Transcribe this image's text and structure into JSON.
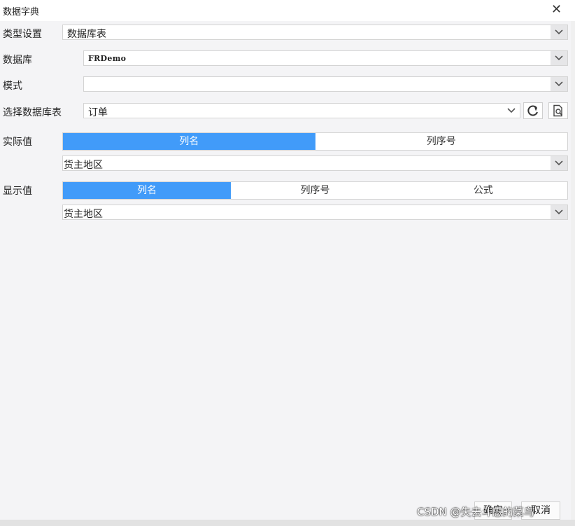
{
  "window": {
    "title": "数据字典",
    "close_label": "✕"
  },
  "fields": {
    "type_setting": {
      "label": "类型设置",
      "value": "数据库表"
    },
    "database": {
      "label": "数据库",
      "value": "FRDemo"
    },
    "schema": {
      "label": "模式",
      "value": ""
    },
    "table": {
      "label": "选择数据库表",
      "value": "订单"
    }
  },
  "actual_value": {
    "label": "实际值",
    "options": [
      "列名",
      "列序号"
    ],
    "selected": "列名",
    "column": "货主地区"
  },
  "display_value": {
    "label": "显示值",
    "options": [
      "列名",
      "列序号",
      "公式"
    ],
    "selected": "列名",
    "column": "货主地区"
  },
  "buttons": {
    "ok": "确定",
    "cancel": "取消"
  },
  "watermark": "CSDN @失去斗志的菜鸟",
  "colors": {
    "accent": "#419bf9",
    "background": "#f4f4f6"
  }
}
